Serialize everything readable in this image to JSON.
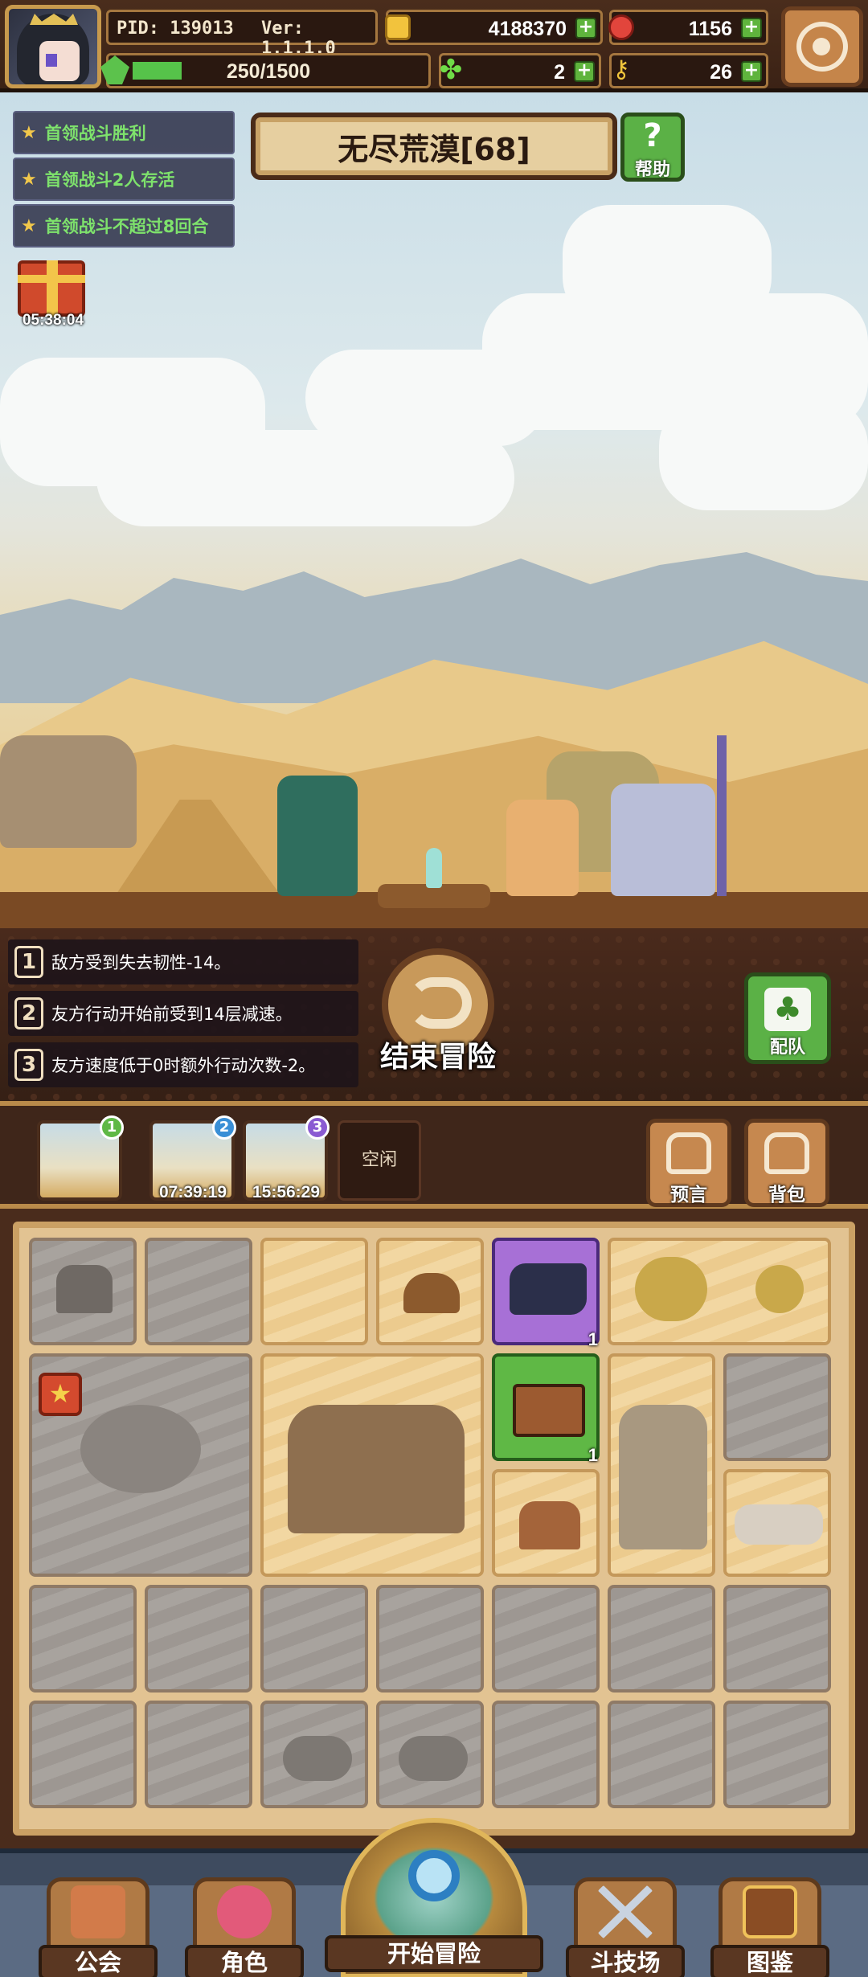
{
  "hud": {
    "pid": "PID: 139013",
    "version": "Ver: 1.1.1.0",
    "gold": "4188370",
    "gems": "1156",
    "energy": "250/1500",
    "energy_fraction": 0.167,
    "clovers": "2",
    "keys": "26"
  },
  "quests": [
    {
      "text": "首领战斗胜利"
    },
    {
      "text": "首领战斗2人存活"
    },
    {
      "text": "首领战斗不超过8回合"
    }
  ],
  "gift": {
    "timer": "05:38:04"
  },
  "stage": {
    "title": "无尽荒漠[68]",
    "help_label": "帮助"
  },
  "buffs": [
    {
      "num": "1",
      "text": "敌方受到失去韧性-14。"
    },
    {
      "num": "2",
      "text": "友方行动开始前受到14层减速。"
    },
    {
      "num": "3",
      "text": "友方速度低于0时额外行动次数-2。"
    }
  ],
  "actions": {
    "end_adventure": "结束冒险",
    "team": "配队"
  },
  "slots": [
    {
      "badge": "1",
      "timer": "",
      "color": "#5fb845"
    },
    {
      "badge": "2",
      "timer": "07:39:19",
      "color": "#3a8fd6"
    },
    {
      "badge": "3",
      "timer": "15:56:29",
      "color": "#8a5bd2"
    }
  ],
  "idle_slot": "空闲",
  "side_buttons": {
    "prophecy": "预言",
    "backpack": "背包"
  },
  "grid_items": [
    {
      "name": "purple-boots-item",
      "count": "1"
    },
    {
      "name": "gold-chest-item",
      "count": "1"
    }
  ],
  "nav": {
    "guild": "公会",
    "character": "角色",
    "start": "开始冒险",
    "arena": "斗技场",
    "codex": "图鉴"
  },
  "colors": {
    "hud_bg": "#4a2d1c",
    "accent_green": "#5fb845",
    "accent_purple": "#a770d6",
    "wood": "#c6884f"
  }
}
